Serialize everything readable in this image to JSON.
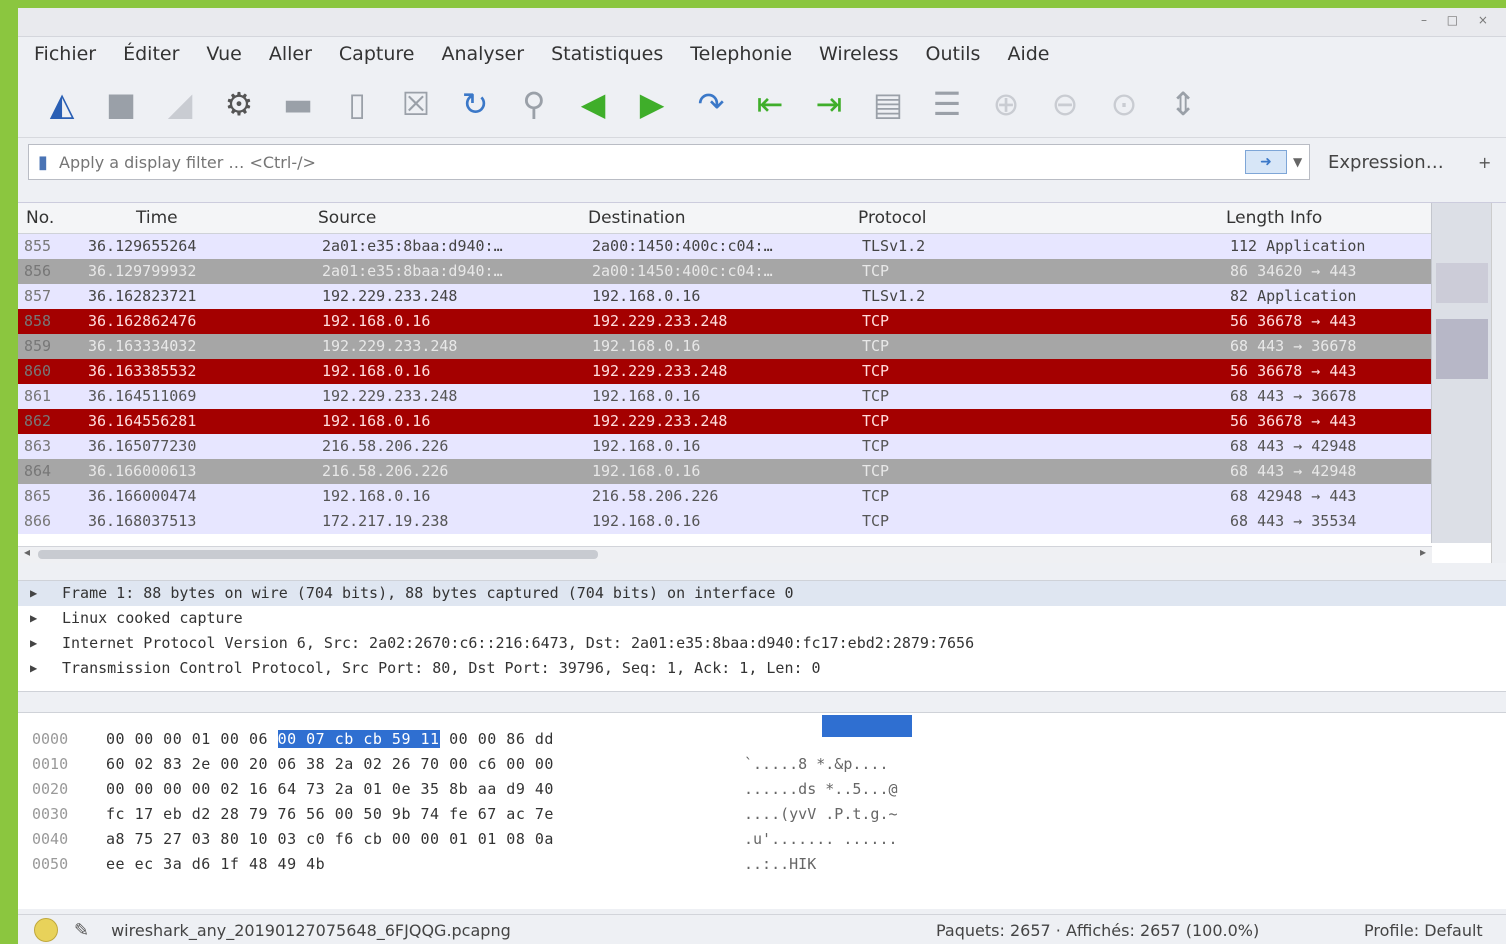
{
  "window": {
    "title": ""
  },
  "menu": [
    "Fichier",
    "Éditer",
    "Vue",
    "Aller",
    "Capture",
    "Analyser",
    "Statistiques",
    "Telephonie",
    "Wireless",
    "Outils",
    "Aide"
  ],
  "toolbar_icons": [
    "shark-fin-icon",
    "stop-icon",
    "restart-icon",
    "options-gear-icon",
    "open-folder-icon",
    "save-file-icon",
    "close-file-icon",
    "reload-icon",
    "find-icon",
    "back-arrow-icon",
    "forward-arrow-icon",
    "goto-packet-icon",
    "first-packet-icon",
    "last-packet-icon",
    "autoscroll-icon",
    "colorize-icon",
    "zoom-in-icon",
    "zoom-out-icon",
    "normal-size-icon",
    "resize-columns-icon"
  ],
  "filter": {
    "placeholder": "Apply a display filter … <Ctrl-/>",
    "expression_label": "Expression…",
    "plus": "+"
  },
  "columns": {
    "no": "No.",
    "time": "Time",
    "source": "Source",
    "destination": "Destination",
    "protocol": "Protocol",
    "length_info": "Length Info"
  },
  "packets": [
    {
      "no": "855",
      "time": "36.129655264",
      "src": "2a01:e35:8baa:d940:…",
      "dst": "2a00:1450:400c:c04:…",
      "proto": "TLSv1.2",
      "info": "112 Application",
      "style": "r-tls"
    },
    {
      "no": "856",
      "time": "36.129799932",
      "src": "2a01:e35:8baa:d940:…",
      "dst": "2a00:1450:400c:c04:…",
      "proto": "TCP",
      "info": "86 34620 → 443",
      "style": "r-gray"
    },
    {
      "no": "857",
      "time": "36.162823721",
      "src": "192.229.233.248",
      "dst": "192.168.0.16",
      "proto": "TLSv1.2",
      "info": "82 Application",
      "style": "r-tls"
    },
    {
      "no": "858",
      "time": "36.162862476",
      "src": "192.168.0.16",
      "dst": "192.229.233.248",
      "proto": "TCP",
      "info": "56 36678 → 443",
      "style": "r-red"
    },
    {
      "no": "859",
      "time": "36.163334032",
      "src": "192.229.233.248",
      "dst": "192.168.0.16",
      "proto": "TCP",
      "info": "68 443 → 36678",
      "style": "r-gray"
    },
    {
      "no": "860",
      "time": "36.163385532",
      "src": "192.168.0.16",
      "dst": "192.229.233.248",
      "proto": "TCP",
      "info": "56 36678 → 443",
      "style": "r-red"
    },
    {
      "no": "861",
      "time": "36.164511069",
      "src": "192.229.233.248",
      "dst": "192.168.0.16",
      "proto": "TCP",
      "info": "68 443 → 36678",
      "style": "r-light"
    },
    {
      "no": "862",
      "time": "36.164556281",
      "src": "192.168.0.16",
      "dst": "192.229.233.248",
      "proto": "TCP",
      "info": "56 36678 → 443",
      "style": "r-red"
    },
    {
      "no": "863",
      "time": "36.165077230",
      "src": "216.58.206.226",
      "dst": "192.168.0.16",
      "proto": "TCP",
      "info": "68 443 → 42948",
      "style": "r-light"
    },
    {
      "no": "864",
      "time": "36.166000613",
      "src": "216.58.206.226",
      "dst": "192.168.0.16",
      "proto": "TCP",
      "info": "68 443 → 42948",
      "style": "r-gray"
    },
    {
      "no": "865",
      "time": "36.166000474",
      "src": "192.168.0.16",
      "dst": "216.58.206.226",
      "proto": "TCP",
      "info": "68 42948 → 443",
      "style": "r-light"
    },
    {
      "no": "866",
      "time": "36.168037513",
      "src": "172.217.19.238",
      "dst": "192.168.0.16",
      "proto": "TCP",
      "info": "68 443 → 35534",
      "style": "r-light"
    }
  ],
  "details": [
    "Frame 1: 88 bytes on wire (704 bits), 88 bytes captured (704 bits) on interface 0",
    "Linux cooked capture",
    "Internet Protocol Version 6, Src: 2a02:2670:c6::216:6473, Dst: 2a01:e35:8baa:d940:fc17:ebd2:2879:7656",
    "Transmission Control Protocol, Src Port: 80, Dst Port: 39796, Seq: 1, Ack: 1, Len: 0"
  ],
  "bytes": [
    {
      "off": "0000",
      "pre": "00 00 00 01 00 06 ",
      "hl": "00 07 cb cb 59 11",
      "post": " 00 00 86 dd",
      "asc": ""
    },
    {
      "off": "0010",
      "pre": "60 02 83 2e 00 20 06 38  2a 02 26 70 00 c6 00 00",
      "hl": "",
      "post": "",
      "asc": "`.....8 *.&p...."
    },
    {
      "off": "0020",
      "pre": "00 00 00 00 02 16 64 73  2a 01 0e 35 8b aa d9 40",
      "hl": "",
      "post": "",
      "asc": "......ds *..5...@"
    },
    {
      "off": "0030",
      "pre": "fc 17 eb d2 28 79 76 56  00 50 9b 74 fe 67 ac 7e",
      "hl": "",
      "post": "",
      "asc": "....(yvV .P.t.g.~"
    },
    {
      "off": "0040",
      "pre": "a8 75 27 03 80 10 03 c0  f6 cb 00 00 01 01 08 0a",
      "hl": "",
      "post": "",
      "asc": ".u'....... ......"
    },
    {
      "off": "0050",
      "pre": "ee ec 3a d6 1f 48 49 4b",
      "hl": "",
      "post": "",
      "asc": "..:..HIK"
    }
  ],
  "status": {
    "file": "wireshark_any_20190127075648_6FJQQG.pcapng",
    "packets": "Paquets: 2657 · Affichés: 2657 (100.0%)",
    "profile": "Profile: Default"
  },
  "colors": {
    "red_row": "#a40000",
    "gray_row": "#a6a6a6",
    "tls_row": "#e7e6ff",
    "selection": "#2f6fd1",
    "desktop": "#8bc63f"
  }
}
